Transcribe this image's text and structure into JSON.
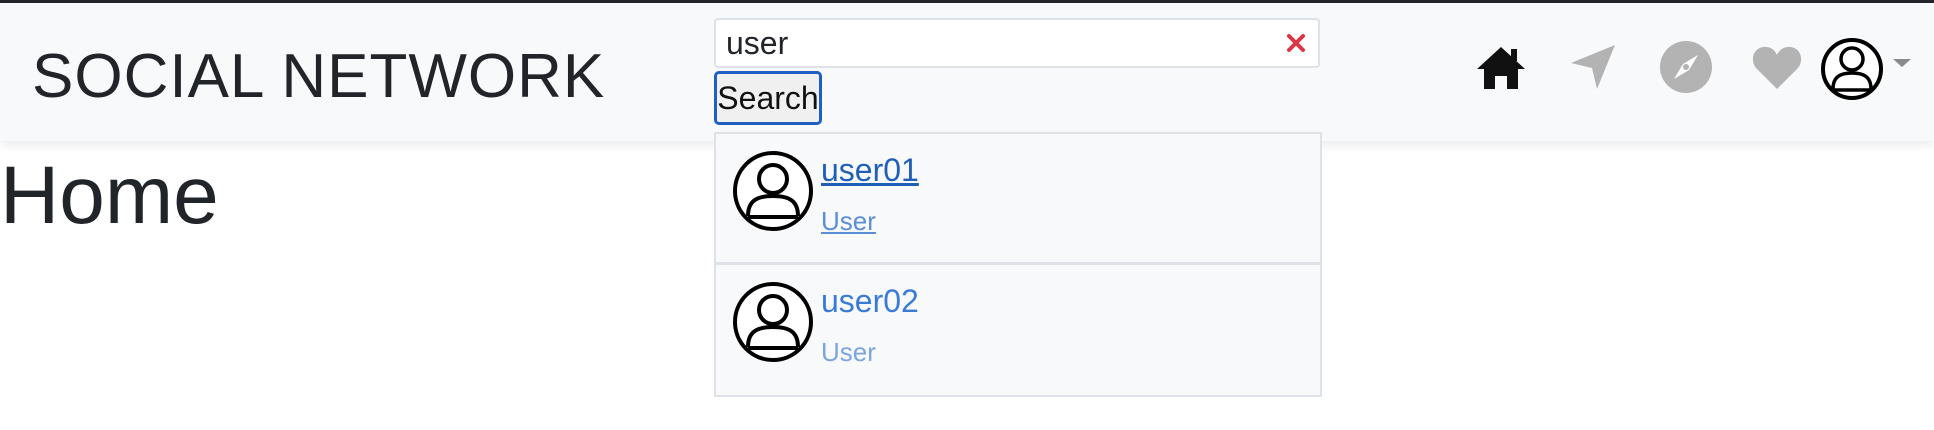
{
  "app": {
    "brand": "SOCIAL NETWORK"
  },
  "search": {
    "value": "user",
    "button_label": "Search"
  },
  "results": [
    {
      "name": "user01",
      "role": "User"
    },
    {
      "name": "user02",
      "role": "User"
    }
  ],
  "page": {
    "title": "Home"
  },
  "nav": {
    "icons": [
      "home-icon",
      "send-icon",
      "explore-icon",
      "heart-icon",
      "profile-avatar-icon",
      "caret-down-icon"
    ],
    "active": "home-icon"
  },
  "colors": {
    "link_primary": "#1f5fb8",
    "link_secondary": "#3a7bd5",
    "clear_icon": "#dc3545",
    "inactive_icon": "#b3b3b3",
    "active_icon": "#111111",
    "focus_border": "#1f5fc1"
  }
}
